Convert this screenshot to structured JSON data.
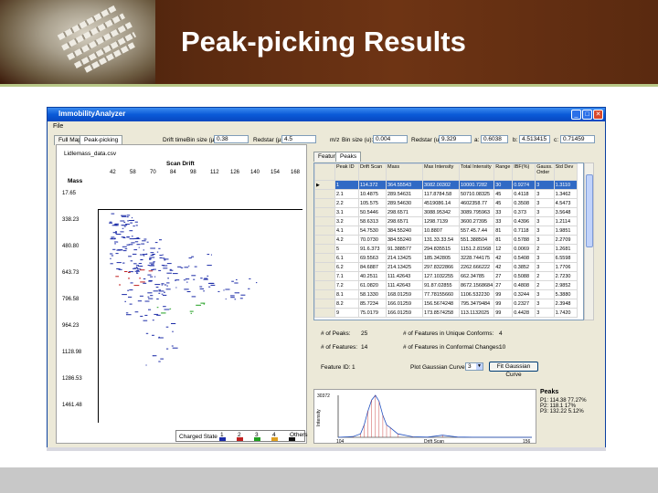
{
  "slide": {
    "title": "Peak-picking Results"
  },
  "window": {
    "title": "ImmobilityAnalyzer",
    "menu": "File",
    "tabs": [
      "Full Map",
      "Peak-picking"
    ],
    "right_tabs": [
      "Features",
      "Peaks"
    ]
  },
  "controls": {
    "drift_time_label": "Drift time",
    "bin_size_label": "Bin size (μs):",
    "bin_size_value": "0.38",
    "redstar_label": "Redstar (μs):",
    "redstar_value": "4.5",
    "mz_label": "m/z",
    "mz_bin_label": "Bin size (u):",
    "mz_bin_value": "0.004",
    "mz_redstar_label": "Redstar (u):",
    "mz_redstar_value": "9.329",
    "a_label": "a:",
    "a_value": "0.6038",
    "b_label": "b:",
    "b_value": "4.513415",
    "c_label": "c:",
    "c_value": "0.71459"
  },
  "left_plot": {
    "file_label": "Lidlemass_data.csv",
    "x_title": "Scan Drift",
    "x_ticks": [
      "42",
      "58",
      "70",
      "84",
      "98",
      "112",
      "126",
      "140",
      "154",
      "168"
    ],
    "y_title": "Mass",
    "y_ticks": [
      "17.65",
      "338.23",
      "480.80",
      "643.73",
      "796.58",
      "964.23",
      "1128.98",
      "1286.53",
      "1461.48"
    ],
    "legend_label": "Charged State",
    "legend_items": [
      {
        "label": "1",
        "color": "#1c2ca8"
      },
      {
        "label": "2",
        "color": "#c02020"
      },
      {
        "label": "3",
        "color": "#20a020"
      },
      {
        "label": "4",
        "color": "#e0a020"
      },
      {
        "label": "Others",
        "color": "#101010"
      }
    ]
  },
  "table": {
    "headers": [
      "Peak ID",
      "Drift Scan",
      "Mass",
      "Max Intensity",
      "Total Intensity",
      "Range",
      "IBF(%)",
      "Gauss. Order",
      "Std Dev"
    ],
    "rows": [
      [
        "1",
        "114.372",
        "364.55543",
        "3082.00302",
        "10000.7282",
        "30",
        "0.9274",
        "3",
        "1.3110"
      ],
      [
        "2.1",
        "10.4875",
        "289.54631",
        "117.8784.58",
        "50710.08325",
        "45",
        "0.4118",
        "3",
        "1.3462"
      ],
      [
        "2.2",
        "105.575",
        "289.54630",
        "4519086.14",
        "4602358.77",
        "45",
        "0.3508",
        "3",
        "4.5473"
      ],
      [
        "3.1",
        "50.5446",
        "298.6571",
        "3088.95342",
        "3089.795963",
        "33",
        "0.373",
        "3",
        "3.5648"
      ],
      [
        "3.2",
        "58.6313",
        "298.6571",
        "1298.7139",
        "3600.27395",
        "33",
        "0.4396",
        "3",
        "1.2114"
      ],
      [
        "4.1",
        "54.7530",
        "384.55240",
        "10.8807",
        "557.45.7.44",
        "81",
        "0.7118",
        "3",
        "1.9851"
      ],
      [
        "4.2",
        "70.0730",
        "384.55240",
        "131.33.33.54",
        "551.388504",
        "81",
        "0.5788",
        "3",
        "2.2709"
      ],
      [
        "5",
        "91.6.373",
        "91.388577",
        "294.835515",
        "1151.2.81568",
        "12",
        "0.0069",
        "2",
        "1.2681"
      ],
      [
        "6.1",
        "69.5563",
        "214.13425",
        "185.342805",
        "3228.744175",
        "42",
        "0.5408",
        "3",
        "6.5598"
      ],
      [
        "6.2",
        "84.6887",
        "214.13425",
        "297.8322866",
        "2262.666222",
        "42",
        "0.3852",
        "3",
        "1.7706"
      ],
      [
        "7.1",
        "40.2511",
        "111.42643",
        "127.1032255",
        "662.34785",
        "27",
        "0.5088",
        "2",
        "2.7230"
      ],
      [
        "7.2",
        "61.0820",
        "111.42643",
        "91.87.02855",
        "8672.1568684",
        "27",
        "0.4808",
        "2",
        "2.9852"
      ],
      [
        "8.1",
        "58.1330",
        "168.01259",
        "77.78155660",
        "1106.532230",
        "99",
        "0.3244",
        "3",
        "5.3880"
      ],
      [
        "8.2",
        "85.7234",
        "166.01259",
        "156.5674248",
        "795.3479484",
        "99",
        "0.2327",
        "3",
        "2.3948"
      ],
      [
        "9",
        "75.0179",
        "166.01259",
        "173.8574258",
        "113.1132025",
        "99",
        "0.4428",
        "3",
        "1.7420"
      ]
    ],
    "selected_row": 0
  },
  "stats": {
    "num_peaks_label": "# of Peaks:",
    "num_peaks_value": "25",
    "num_unique_label": "# of Features in Unique Conforms:",
    "num_unique_value": "4",
    "num_features_label": "# of Features:",
    "num_features_value": "14",
    "num_conformal_label": "# of Features in Conformal Changes:",
    "num_conformal_value": "10"
  },
  "feature_row": {
    "feature_id_label": "Feature ID:",
    "feature_id_value": "1",
    "gaussian_label": "Plot Gaussian Curve",
    "gaussian_value": "3",
    "fit_button": "Fit Gaussian Curve"
  },
  "peak_chart": {
    "y_top": "30372",
    "y_label": "Intensity",
    "x_left": "104",
    "x_mid": "Drift Scan",
    "x_right": "156"
  },
  "peaks_box": {
    "title": "Peaks",
    "lines": [
      "P1: 114.38   77.27%",
      "P2: 118.1    17%",
      "P3: 132.22   5.12%"
    ]
  },
  "chart_data": {
    "type": "line",
    "x": [
      104,
      108,
      110,
      111,
      112,
      113,
      114,
      115,
      116,
      117,
      118,
      120,
      124,
      128,
      132,
      136,
      140,
      148,
      156
    ],
    "series": [
      {
        "values": [
          0,
          500,
          2500,
          9000,
          19000,
          27000,
          30372,
          26000,
          16000,
          9000,
          7000,
          2500,
          400,
          150,
          1500,
          200,
          50,
          0,
          0
        ]
      }
    ],
    "ylim": [
      0,
      30372
    ],
    "xlim": [
      104,
      156
    ]
  }
}
